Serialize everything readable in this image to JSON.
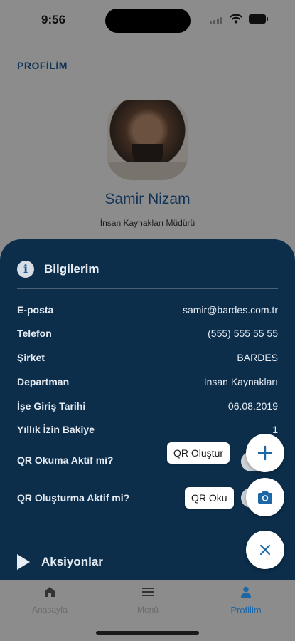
{
  "status_bar": {
    "time": "9:56"
  },
  "header": {
    "title": "PROFİLİM"
  },
  "profile": {
    "name": "Samir Nizam",
    "title": "İnsan Kaynakları Müdürü"
  },
  "info": {
    "title": "Bilgilerim",
    "rows": [
      {
        "label": "E-posta",
        "value": "samir@bardes.com.tr"
      },
      {
        "label": "Telefon",
        "value": "(555) 555 55 55"
      },
      {
        "label": "Şirket",
        "value": "BARDES"
      },
      {
        "label": "Departman",
        "value": "İnsan Kaynakları"
      },
      {
        "label": "İşe Giriş Tarihi",
        "value": "06.08.2019"
      },
      {
        "label": "Yıllık İzin Bakiye",
        "value": "1"
      }
    ],
    "toggles": [
      {
        "label": "QR Okuma Aktif mi?",
        "on": true
      },
      {
        "label": "QR Oluşturma Aktif mi?",
        "on": true
      }
    ]
  },
  "actions": {
    "title": "Aksiyonlar"
  },
  "fab": {
    "qr_create_label": "QR Oluştur",
    "qr_read_label": "QR Oku",
    "accent": "#1d67a6"
  },
  "tabs": [
    {
      "label": "Anasayfa",
      "icon": "home-icon",
      "active": false
    },
    {
      "label": "Menü",
      "icon": "menu-icon",
      "active": false
    },
    {
      "label": "Profilim",
      "icon": "person-icon",
      "active": true
    }
  ]
}
